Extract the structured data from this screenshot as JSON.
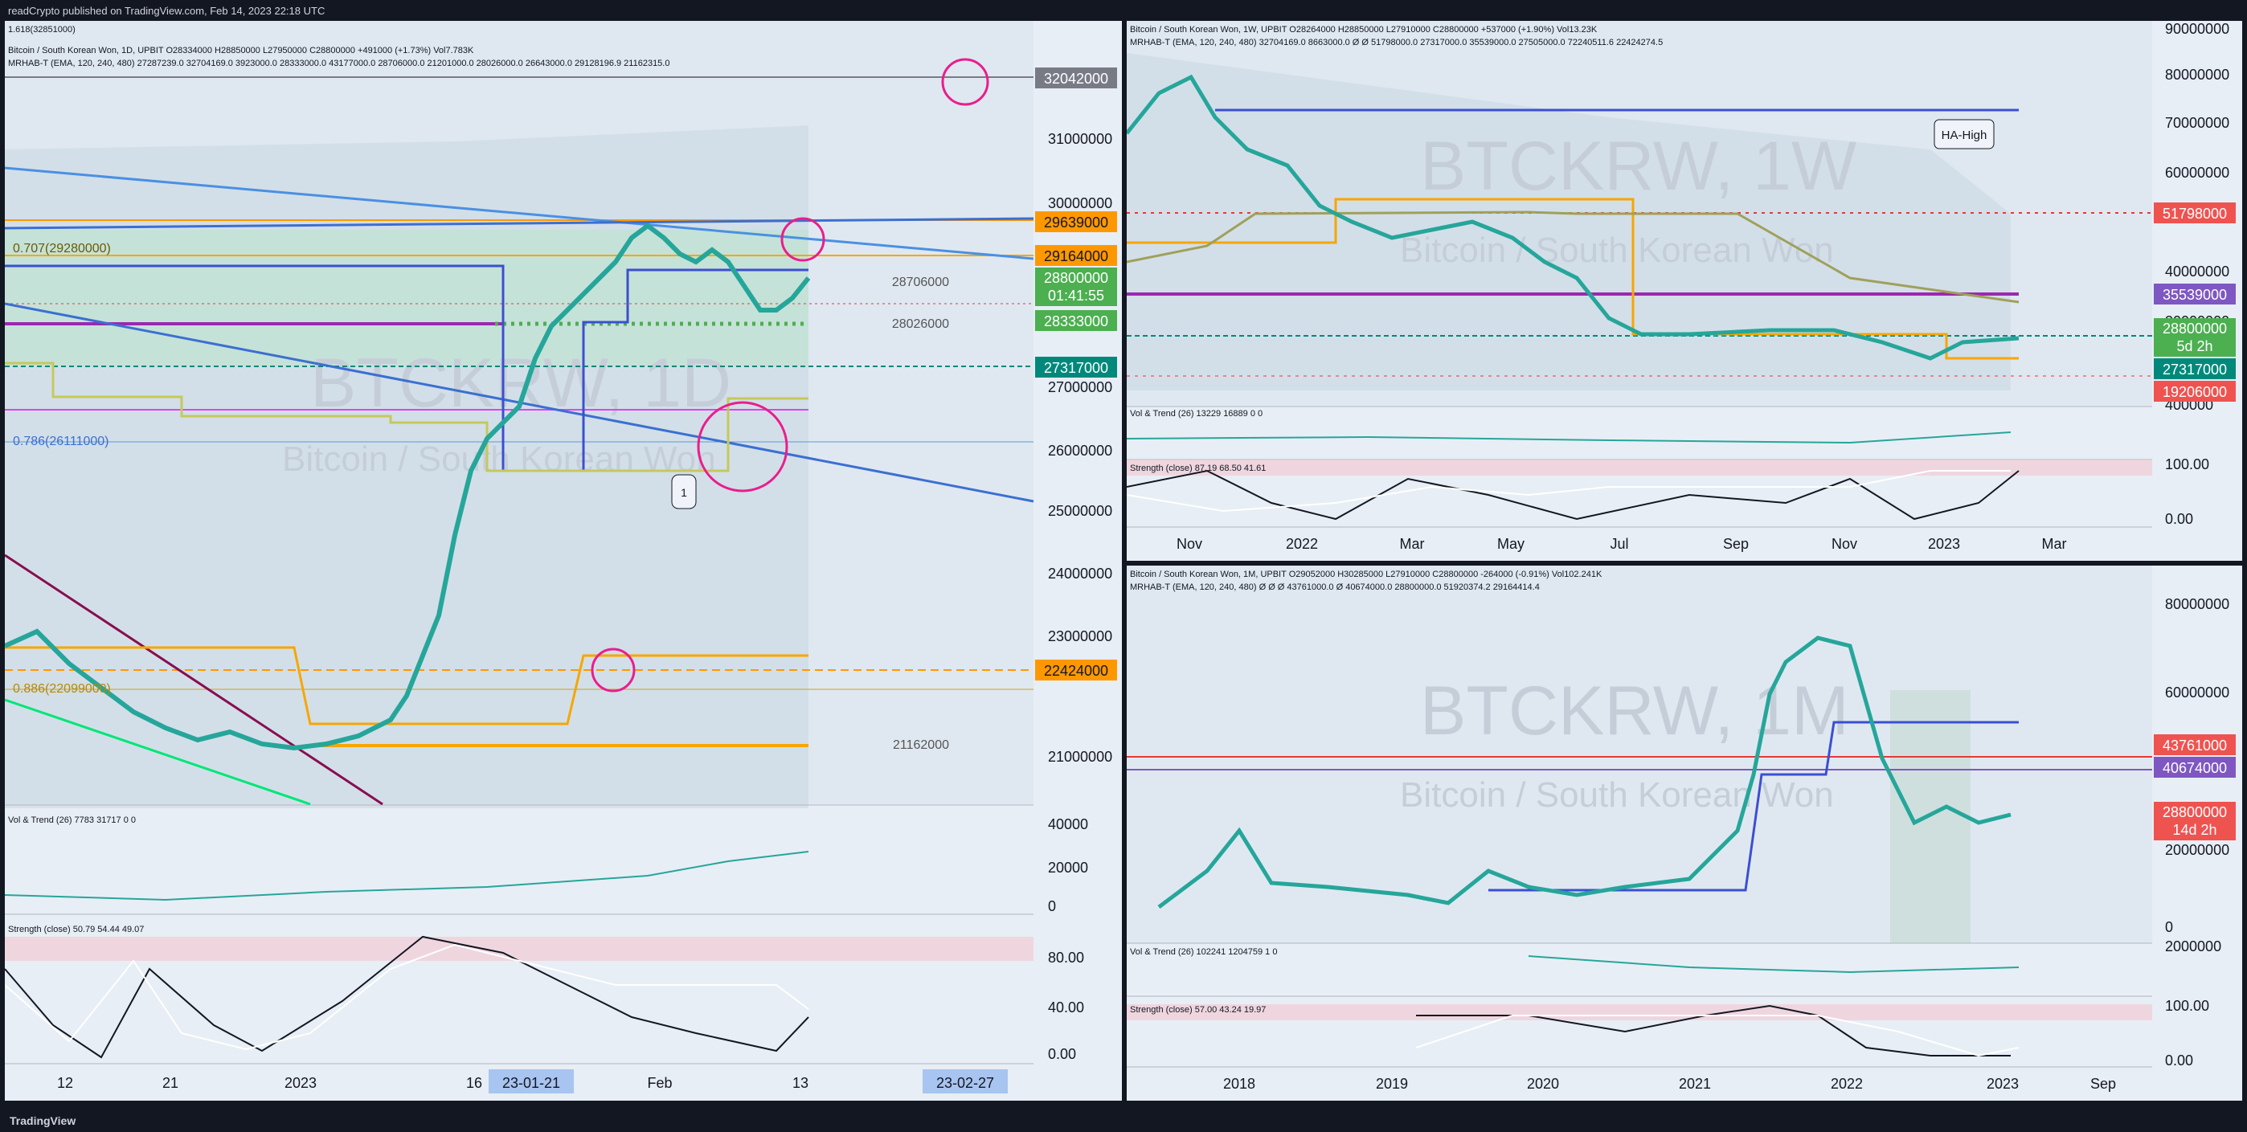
{
  "header": {
    "published": "readCrypto published on TradingView.com, Feb 14, 2023 22:18 UTC"
  },
  "footer": {
    "brand": "TradingView"
  },
  "colors": {
    "background": "#131722",
    "pane": "#e8eef5",
    "up": "#26a69a",
    "down": "#ef5350",
    "price_label": "#4caf50"
  },
  "panes": {
    "daily": {
      "legend1": "Bitcoin / South Korean Won, 1D, UPBIT  O28334000 H28850000 L27950000 C28800000 +491000 (+1.73%) Vol7.783K",
      "legend2": "MRHAB-T (EMA, 120, 240, 480)  27287239.0  32704169.0  3923000.0  28333000.0  43177000.0  28706000.0  21201000.0  28026000.0  26643000.0  29128196.9  21162315.0",
      "watermark": "BTCKRW, 1D",
      "watermark_sub": "Bitcoin / South Korean Won",
      "top_fib": "1.618(32851000)",
      "fib_707": "0.707(29280000)",
      "fib_786": "0.786(26111000)",
      "fib_886": "0.886(22099000)",
      "axis_ticks": [
        "31000000",
        "30000000",
        "27000000",
        "26000000",
        "25000000",
        "24000000",
        "23000000",
        "21000000"
      ],
      "price_labels": {
        "p1": "32042000",
        "p2": "29639000",
        "p3": "29164000",
        "p4": "28800000",
        "p4_timer": "01:41:55",
        "p5": "28333000",
        "p6": "27317000",
        "p7": "22424000"
      },
      "inline_labels": {
        "a": "28706000",
        "b": "28026000",
        "c": "21162000"
      },
      "marker": "1",
      "vol_legend": "Vol & Trend (26)  7783  31717  0  0",
      "vol_ticks": [
        "40000",
        "20000",
        "0"
      ],
      "strength_legend": "Strength (close)  50.79  54.44  49.07",
      "strength_ticks": [
        "80.00",
        "40.00",
        "0.00"
      ],
      "time_ticks": [
        "12",
        "21",
        "2023",
        "16",
        "Feb",
        "13"
      ],
      "time_hl1": "23-01-21",
      "time_hl2": "23-02-27"
    },
    "weekly": {
      "legend1": "Bitcoin / South Korean Won, 1W, UPBIT  O28264000 H28850000 L27910000 C28800000 +537000 (+1.90%) Vol13.23K",
      "legend2": "MRHAB-T (EMA, 120, 240, 480)  32704169.0  8663000.0  Ø  Ø  51798000.0  27317000.0  35539000.0  27505000.0  72240511.6  22424274.5",
      "watermark": "BTCKRW, 1W",
      "watermark_sub": "Bitcoin / South Korean Won",
      "ha_label": "HA-High",
      "axis_ticks": [
        "90000000",
        "80000000",
        "70000000",
        "60000000",
        "40000000",
        "30000000",
        "400000"
      ],
      "price_labels": {
        "p1": "51798000",
        "p2": "35539000",
        "p3": "28800000",
        "p3_timer": "5d 2h",
        "p4": "27317000",
        "p5": "19206000"
      },
      "vol_legend": "Vol & Trend (26)  13229  16889  0  0",
      "strength_legend": "Strength (close)  87.19  68.50  41.61",
      "strength_ticks": [
        "100.00",
        "0.00"
      ],
      "time_ticks": [
        "Nov",
        "2022",
        "Mar",
        "May",
        "Jul",
        "Sep",
        "Nov",
        "2023",
        "Mar"
      ]
    },
    "monthly": {
      "legend1": "Bitcoin / South Korean Won, 1M, UPBIT  O29052000 H30285000 L27910000 C28800000 -264000 (-0.91%) Vol102.241K",
      "legend2": "MRHAB-T (EMA, 120, 240, 480)  Ø  Ø  Ø  43761000.0  Ø  40674000.0  28800000.0  51920374.2  29164414.4",
      "watermark": "BTCKRW, 1M",
      "watermark_sub": "Bitcoin / South Korean Won",
      "axis_ticks": [
        "80000000",
        "60000000",
        "20000000",
        "0",
        "2000000"
      ],
      "price_labels": {
        "p1": "43761000",
        "p2": "40674000",
        "p3": "28800000",
        "p3_timer": "14d 2h"
      },
      "vol_legend": "Vol & Trend (26)  102241  1204759  1  0",
      "strength_legend": "Strength (close)  57.00  43.24  19.97",
      "strength_ticks": [
        "100.00",
        "0.00"
      ],
      "time_ticks": [
        "2018",
        "2019",
        "2020",
        "2021",
        "2022",
        "2023",
        "Sep"
      ]
    }
  }
}
